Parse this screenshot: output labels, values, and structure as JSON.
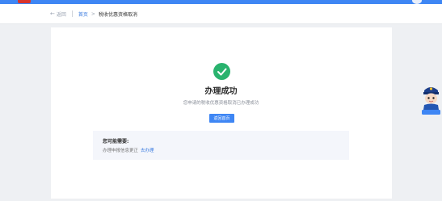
{
  "breadcrumb": {
    "back_label": "返回",
    "home_label": "首页",
    "separator": ">",
    "current_label": "税收优惠资格取消"
  },
  "result": {
    "icon": "check-circle-icon",
    "title": "办理成功",
    "description": "您申请的税收优惠资格取消已办理成功",
    "home_button_label": "返回首页"
  },
  "needs": {
    "title": "您可能需要:",
    "item_text": "办理申报信息更正",
    "item_link": "去办理"
  },
  "colors": {
    "accent": "#3e86f4",
    "success": "#29b36e",
    "brand_red": "#d9342b"
  },
  "assistant": {
    "icon": "police-mascot-icon"
  }
}
